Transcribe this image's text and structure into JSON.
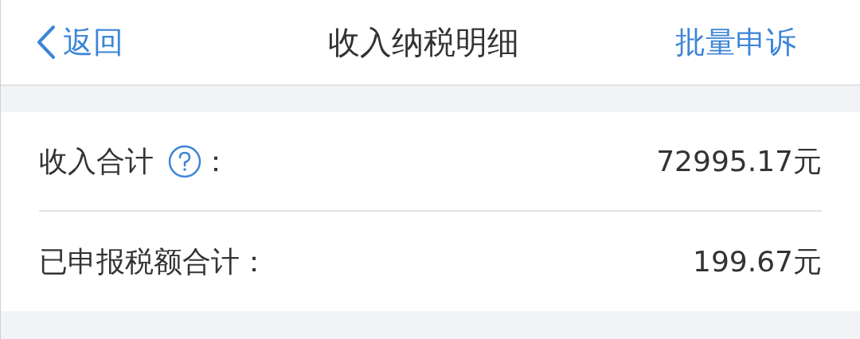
{
  "header": {
    "back_label": "返回",
    "title": "收入纳税明细",
    "action": "批量申诉"
  },
  "summary": [
    {
      "label": "收入合计",
      "help": true,
      "colon": "：",
      "value": "72995.17元"
    },
    {
      "label": "已申报税额合计：",
      "help": false,
      "value": "199.67元"
    }
  ]
}
